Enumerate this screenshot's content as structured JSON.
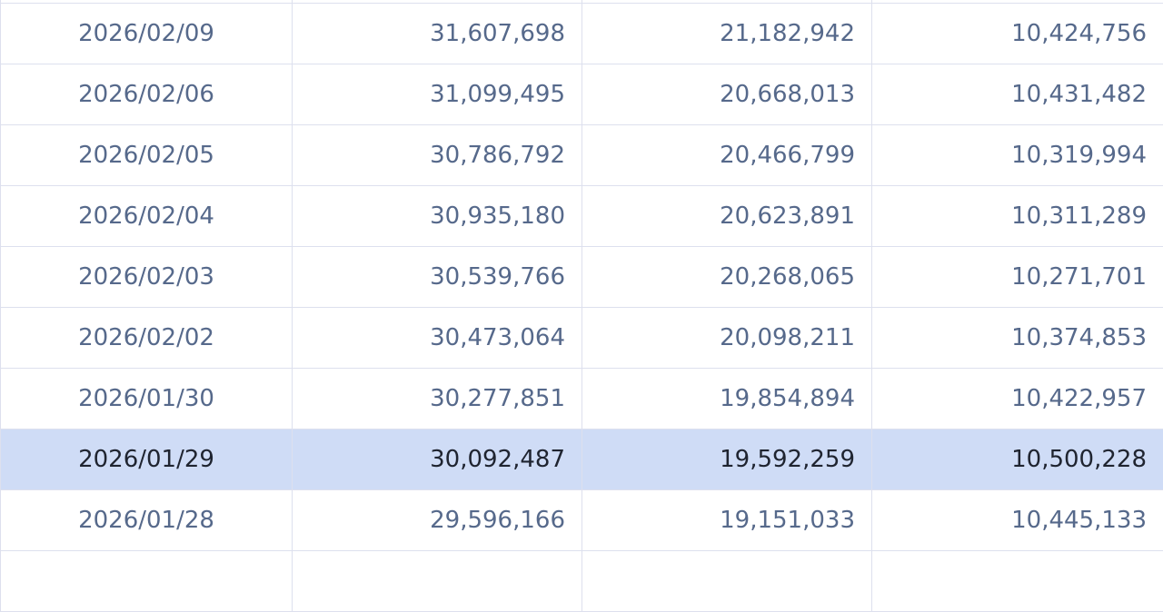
{
  "table": {
    "rows": [
      {
        "date": "",
        "c1": "",
        "c2": "",
        "c3": "",
        "highlighted": false
      },
      {
        "date": "2026/02/09",
        "c1": "31,607,698",
        "c2": "21,182,942",
        "c3": "10,424,756",
        "highlighted": false
      },
      {
        "date": "2026/02/06",
        "c1": "31,099,495",
        "c2": "20,668,013",
        "c3": "10,431,482",
        "highlighted": false
      },
      {
        "date": "2026/02/05",
        "c1": "30,786,792",
        "c2": "20,466,799",
        "c3": "10,319,994",
        "highlighted": false
      },
      {
        "date": "2026/02/04",
        "c1": "30,935,180",
        "c2": "20,623,891",
        "c3": "10,311,289",
        "highlighted": false
      },
      {
        "date": "2026/02/03",
        "c1": "30,539,766",
        "c2": "20,268,065",
        "c3": "10,271,701",
        "highlighted": false
      },
      {
        "date": "2026/02/02",
        "c1": "30,473,064",
        "c2": "20,098,211",
        "c3": "10,374,853",
        "highlighted": false
      },
      {
        "date": "2026/01/30",
        "c1": "30,277,851",
        "c2": "19,854,894",
        "c3": "10,422,957",
        "highlighted": false
      },
      {
        "date": "2026/01/29",
        "c1": "30,092,487",
        "c2": "19,592,259",
        "c3": "10,500,228",
        "highlighted": true
      },
      {
        "date": "2026/01/28",
        "c1": "29,596,166",
        "c2": "19,151,033",
        "c3": "10,445,133",
        "highlighted": false
      },
      {
        "date": "",
        "c1": "",
        "c2": "",
        "c3": "",
        "highlighted": false
      }
    ]
  },
  "colors": {
    "text": "#56698b",
    "grid": "#dde0ee",
    "highlight_bg": "#cfdcf6",
    "highlight_text": "#1f2430"
  }
}
